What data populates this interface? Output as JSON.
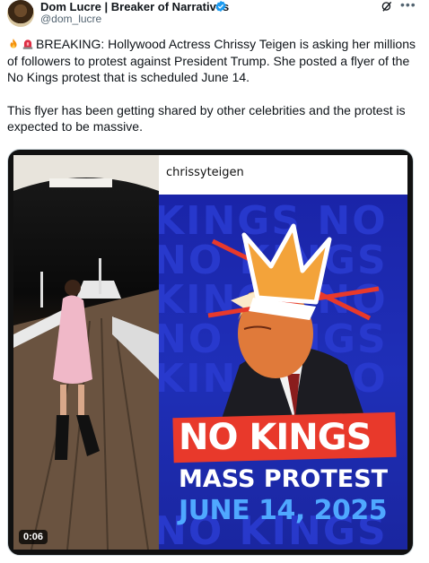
{
  "author": {
    "display_name": "Dom Lucre | Breaker of Narratives",
    "handle": "@dom_lucre",
    "verified": true
  },
  "tweet": {
    "paragraph_1": "BREAKING: Hollywood Actress Chrissy Teigen is asking her millions of followers to protest against President Trump. She posted a flyer of the No Kings protest that is scheduled June 14.",
    "paragraph_2": "This flyer has been getting shared by other celebrities and the protest is expected to be massive.",
    "emojis": [
      "fire-emoji",
      "rotating-light-emoji"
    ]
  },
  "media": {
    "instagram_username": "chrissyteigen",
    "poster_headline": "NO KINGS",
    "poster_subhead": "MASS PROTEST",
    "poster_date": "JUNE 14, 2025",
    "video_time": "0:06"
  },
  "colors": {
    "verified_blue": "#1d9bf0",
    "poster_blue": "#1f2fb8",
    "poster_red": "#e8392b",
    "poster_date_blue": "#4fa8ff"
  },
  "icons": [
    "verified-badge-icon",
    "grok-icon",
    "more-icon"
  ]
}
